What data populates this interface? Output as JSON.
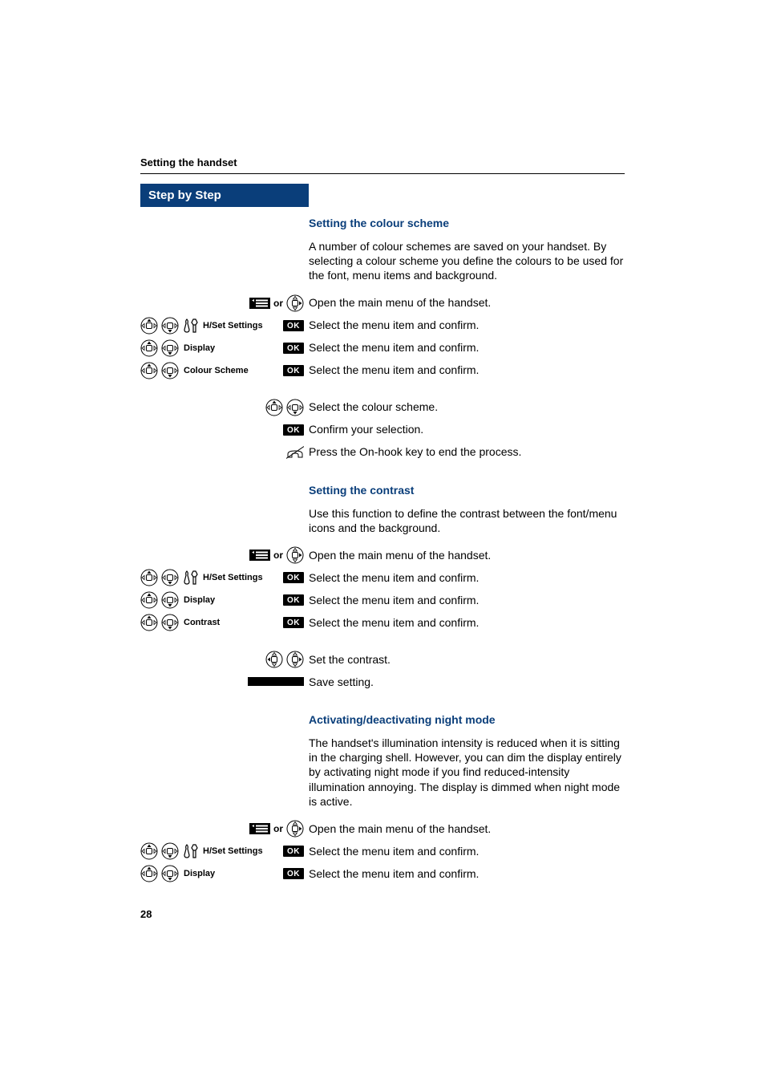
{
  "header": {
    "title": "Setting the handset"
  },
  "sidebar": {
    "step_header": "Step by Step"
  },
  "sections": {
    "colour": {
      "heading": "Setting the colour scheme",
      "intro": "A number of colour schemes are saved on your handset. By selecting a colour scheme you define the colours to be used for the font, menu items and background.",
      "open_main": "Open the main menu of the handset.",
      "hset": "H/Set Settings",
      "hset_desc": "Select the menu item and confirm.",
      "display": "Display",
      "display_desc": "Select the menu item and confirm.",
      "colour_scheme": "Colour Scheme",
      "colour_scheme_desc": "Select the menu item and confirm.",
      "select_scheme": "Select the colour scheme.",
      "confirm_sel": "Confirm your selection.",
      "onhook": "Press the On-hook key to end the process."
    },
    "contrast": {
      "heading": "Setting the contrast",
      "intro": "Use this function to define the contrast between the font/menu icons and the background.",
      "open_main": "Open the main menu of the handset.",
      "hset": "H/Set Settings",
      "hset_desc": "Select the menu item and confirm.",
      "display": "Display",
      "display_desc": "Select the menu item and confirm.",
      "contrast": "Contrast",
      "contrast_desc": "Select the menu item and confirm.",
      "set_contrast": "Set the contrast.",
      "save": "Save setting."
    },
    "night": {
      "heading": "Activating/deactivating night mode",
      "intro": "The handset's illumination intensity is reduced when it is sitting in the charging shell. However, you can dim the display entirely by activating night mode if you find reduced-intensity illumination annoying. The display is dimmed when night mode is active.",
      "open_main": "Open the main menu of the handset.",
      "hset": "H/Set Settings",
      "hset_desc": "Select the menu item and confirm.",
      "display": "Display",
      "display_desc": "Select the menu item and confirm."
    }
  },
  "labels": {
    "or": "or",
    "ok": "OK"
  },
  "page_number": "28"
}
